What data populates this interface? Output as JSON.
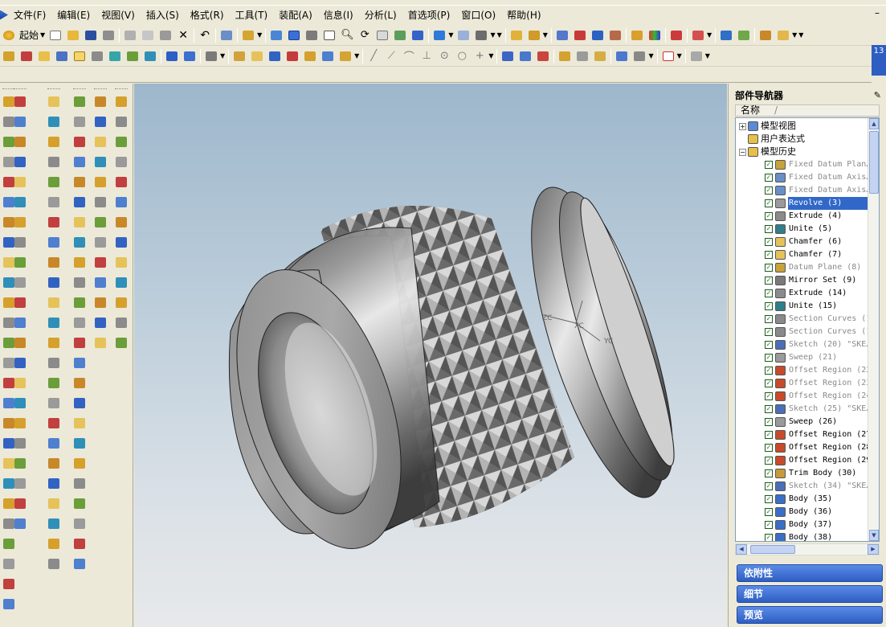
{
  "menubar": {
    "items": [
      "文件(F)",
      "编辑(E)",
      "视图(V)",
      "插入(S)",
      "格式(R)",
      "工具(T)",
      "装配(A)",
      "信息(I)",
      "分析(L)",
      "首选项(P)",
      "窗口(O)",
      "帮助(H)"
    ],
    "minimize_label": "–"
  },
  "toolbar": {
    "start_label": "起始"
  },
  "status": {
    "clock_text": "13"
  },
  "viewport": {
    "axes": {
      "x": "XC",
      "y": "YC",
      "z": "ZC"
    }
  },
  "navigator": {
    "title": "部件导航器",
    "column_header": "名称",
    "sort_indicator": "/",
    "tree_items": [
      {
        "label": "模型视图",
        "type": "group",
        "expander": "+",
        "icon": "model-views-icon"
      },
      {
        "label": "用户表达式",
        "type": "group",
        "expander": "",
        "icon": "folder-icon"
      },
      {
        "label": "模型历史",
        "type": "group",
        "expander": "−",
        "icon": "folder-open-icon"
      },
      {
        "label": "Fixed Datum Plan…",
        "type": "feature",
        "state": "suppressed",
        "icon": "datum-plane-icon"
      },
      {
        "label": "Fixed Datum Axis…",
        "type": "feature",
        "state": "suppressed",
        "icon": "datum-axis-icon"
      },
      {
        "label": "Fixed Datum Axis…",
        "type": "feature",
        "state": "suppressed",
        "icon": "datum-axis-icon"
      },
      {
        "label": "Revolve (3)",
        "type": "feature",
        "state": "selected",
        "icon": "revolve-icon"
      },
      {
        "label": "Extrude (4)",
        "type": "feature",
        "state": "normal",
        "icon": "extrude-icon"
      },
      {
        "label": "Unite (5)",
        "type": "feature",
        "state": "normal",
        "icon": "unite-icon"
      },
      {
        "label": "Chamfer (6)",
        "type": "feature",
        "state": "normal",
        "icon": "chamfer-icon"
      },
      {
        "label": "Chamfer (7)",
        "type": "feature",
        "state": "normal",
        "icon": "chamfer-icon"
      },
      {
        "label": "Datum Plane (8)",
        "type": "feature",
        "state": "suppressed",
        "icon": "datum-plane-icon"
      },
      {
        "label": "Mirror Set (9)",
        "type": "feature",
        "state": "normal",
        "icon": "mirror-set-icon"
      },
      {
        "label": "Extrude (14)",
        "type": "feature",
        "state": "normal",
        "icon": "extrude-icon"
      },
      {
        "label": "Unite (15)",
        "type": "feature",
        "state": "normal",
        "icon": "unite-icon"
      },
      {
        "label": "Section Curves (1…",
        "type": "feature",
        "state": "suppressed",
        "icon": "section-curves-icon"
      },
      {
        "label": "Section Curves (1…",
        "type": "feature",
        "state": "suppressed",
        "icon": "section-curves-icon"
      },
      {
        "label": "Sketch (20) \"SKE…",
        "type": "feature",
        "state": "suppressed",
        "icon": "sketch-icon"
      },
      {
        "label": "Sweep (21)",
        "type": "feature",
        "state": "suppressed",
        "icon": "sweep-icon"
      },
      {
        "label": "Offset Region (22…",
        "type": "feature",
        "state": "suppressed",
        "icon": "offset-region-icon"
      },
      {
        "label": "Offset Region (23…",
        "type": "feature",
        "state": "suppressed",
        "icon": "offset-region-icon"
      },
      {
        "label": "Offset Region (24…",
        "type": "feature",
        "state": "suppressed",
        "icon": "offset-region-icon"
      },
      {
        "label": "Sketch (25) \"SKE…",
        "type": "feature",
        "state": "suppressed",
        "icon": "sketch-icon"
      },
      {
        "label": "Sweep (26)",
        "type": "feature",
        "state": "normal",
        "icon": "sweep-icon"
      },
      {
        "label": "Offset Region (27…",
        "type": "feature",
        "state": "normal",
        "icon": "offset-region-icon"
      },
      {
        "label": "Offset Region (28…",
        "type": "feature",
        "state": "normal",
        "icon": "offset-region-icon"
      },
      {
        "label": "Offset Region (29…",
        "type": "feature",
        "state": "normal",
        "icon": "offset-region-icon"
      },
      {
        "label": "Trim Body (30)",
        "type": "feature",
        "state": "normal",
        "icon": "trim-body-icon"
      },
      {
        "label": "Sketch (34) \"SKE…",
        "type": "feature",
        "state": "suppressed",
        "icon": "sketch-icon"
      },
      {
        "label": "Body (35)",
        "type": "feature",
        "state": "normal",
        "icon": "body-icon"
      },
      {
        "label": "Body (36)",
        "type": "feature",
        "state": "normal",
        "icon": "body-icon"
      },
      {
        "label": "Body (37)",
        "type": "feature",
        "state": "normal",
        "icon": "body-icon"
      },
      {
        "label": "Body (38)",
        "type": "feature",
        "state": "normal",
        "icon": "body-icon"
      }
    ],
    "panels": [
      "依附性",
      "细节",
      "预览"
    ]
  },
  "colors": {
    "selection": "#3168c8",
    "panel_button": "#2e5ec2",
    "suppressed_text": "#8a8a8a",
    "check_green": "#1c7a1c"
  }
}
